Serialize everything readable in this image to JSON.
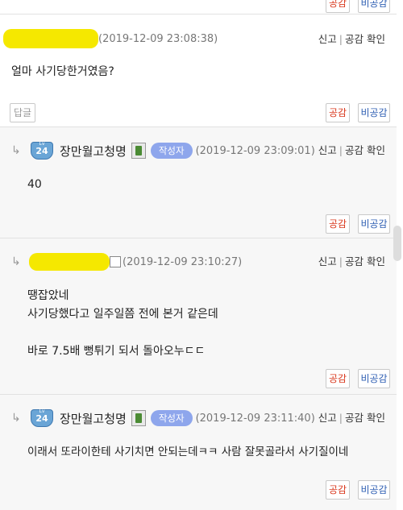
{
  "top": {
    "like_label": "공감",
    "dislike_label": "비공감"
  },
  "comment1": {
    "date": "(2019-12-09 23:08:38)",
    "report": "신고",
    "empathy_check": "공감 확인",
    "text": "얼마 사기당한거였음?",
    "reply_label": "답글",
    "like_label": "공감",
    "dislike_label": "비공감"
  },
  "reply1": {
    "name": "장만월고청명",
    "level": "24",
    "badge": "작성자",
    "date": "(2019-12-09 23:09:01)",
    "report": "신고",
    "empathy_check": "공감 확인",
    "text": "40",
    "like_label": "공감",
    "dislike_label": "비공감"
  },
  "reply2": {
    "date": "(2019-12-09 23:10:27)",
    "report": "신고",
    "empathy_check": "공감 확인",
    "line1": "땡잡았네",
    "line2": "사기당했다고 일주일쯤 전에 본거 같은데",
    "line3": "바로 7.5배 뻥튀기 되서 돌아오누ㄷㄷ",
    "like_label": "공감",
    "dislike_label": "비공감"
  },
  "reply3": {
    "name": "장만월고청명",
    "level": "24",
    "badge": "작성자",
    "date": "(2019-12-09 23:11:40)",
    "report": "신고",
    "empathy_check": "공감 확인",
    "text": "이래서 또라이한테 사기치면 안되는데ㅋㅋ 사람 잘못골라서 사기질이네",
    "like_label": "공감",
    "dislike_label": "비공감"
  }
}
